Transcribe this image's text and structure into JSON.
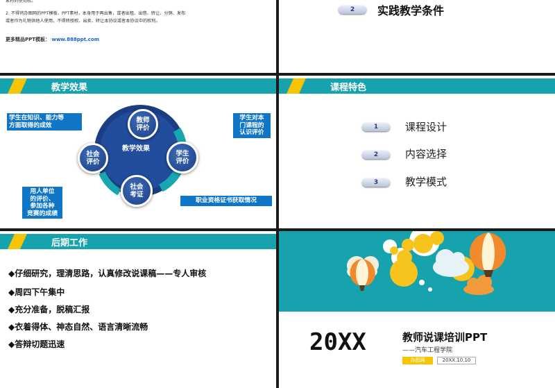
{
  "top_left": {
    "lines": [
      "2. 不得将办图网的PPT模板、PPT素材，本身用于再出售，或者出租、出借、转让、分销、发布",
      "或者作为礼物供他人使用，不得转授权、出卖、转让本协议或者本协议中的权利。"
    ],
    "more_label": "更多精品PPT模板：",
    "more_link": "www.888ppt.com"
  },
  "top_right": {
    "number": "2",
    "label": "实践教学条件"
  },
  "mid_left": {
    "title": "教学效果",
    "center": "教学效果",
    "nodes": {
      "teacher": "教师\n评价",
      "student": "学生\n评价",
      "social1": "社会\n评价",
      "social2": "社会\n考证"
    },
    "bubbles": {
      "top_left": "学生在知识、能力等\n方面取得的成效",
      "top_right": "学生对本\n门课程的\n认识评价",
      "bottom_left": "用人单位\n的评价、\n参加各种\n竞赛的成绩",
      "bottom_right": "职业资格证书获取情况"
    }
  },
  "mid_right": {
    "title": "课程特色",
    "items": [
      {
        "num": "1",
        "label": "课程设计"
      },
      {
        "num": "2",
        "label": "内容选择"
      },
      {
        "num": "3",
        "label": "教学模式"
      }
    ]
  },
  "bot_left": {
    "title": "后期工作",
    "items": [
      "◆仔细研究，理清思路，认真修改说课稿——专人审核",
      "◆周四下午集中",
      "◆充分准备，脱稿汇报",
      "◆衣着得体、神态自然、语言清晰流畅",
      "◆答辩切题迅速"
    ]
  },
  "bot_right": {
    "year": "20XX",
    "title": "教师说课培训PPT",
    "subtitle": "——汽车工程学院",
    "tag": "办图网",
    "date": "20XX.10.10"
  },
  "colors": {
    "teal": "#17a3ad",
    "yellow": "#f6c400",
    "blue": "#0f76c7"
  }
}
